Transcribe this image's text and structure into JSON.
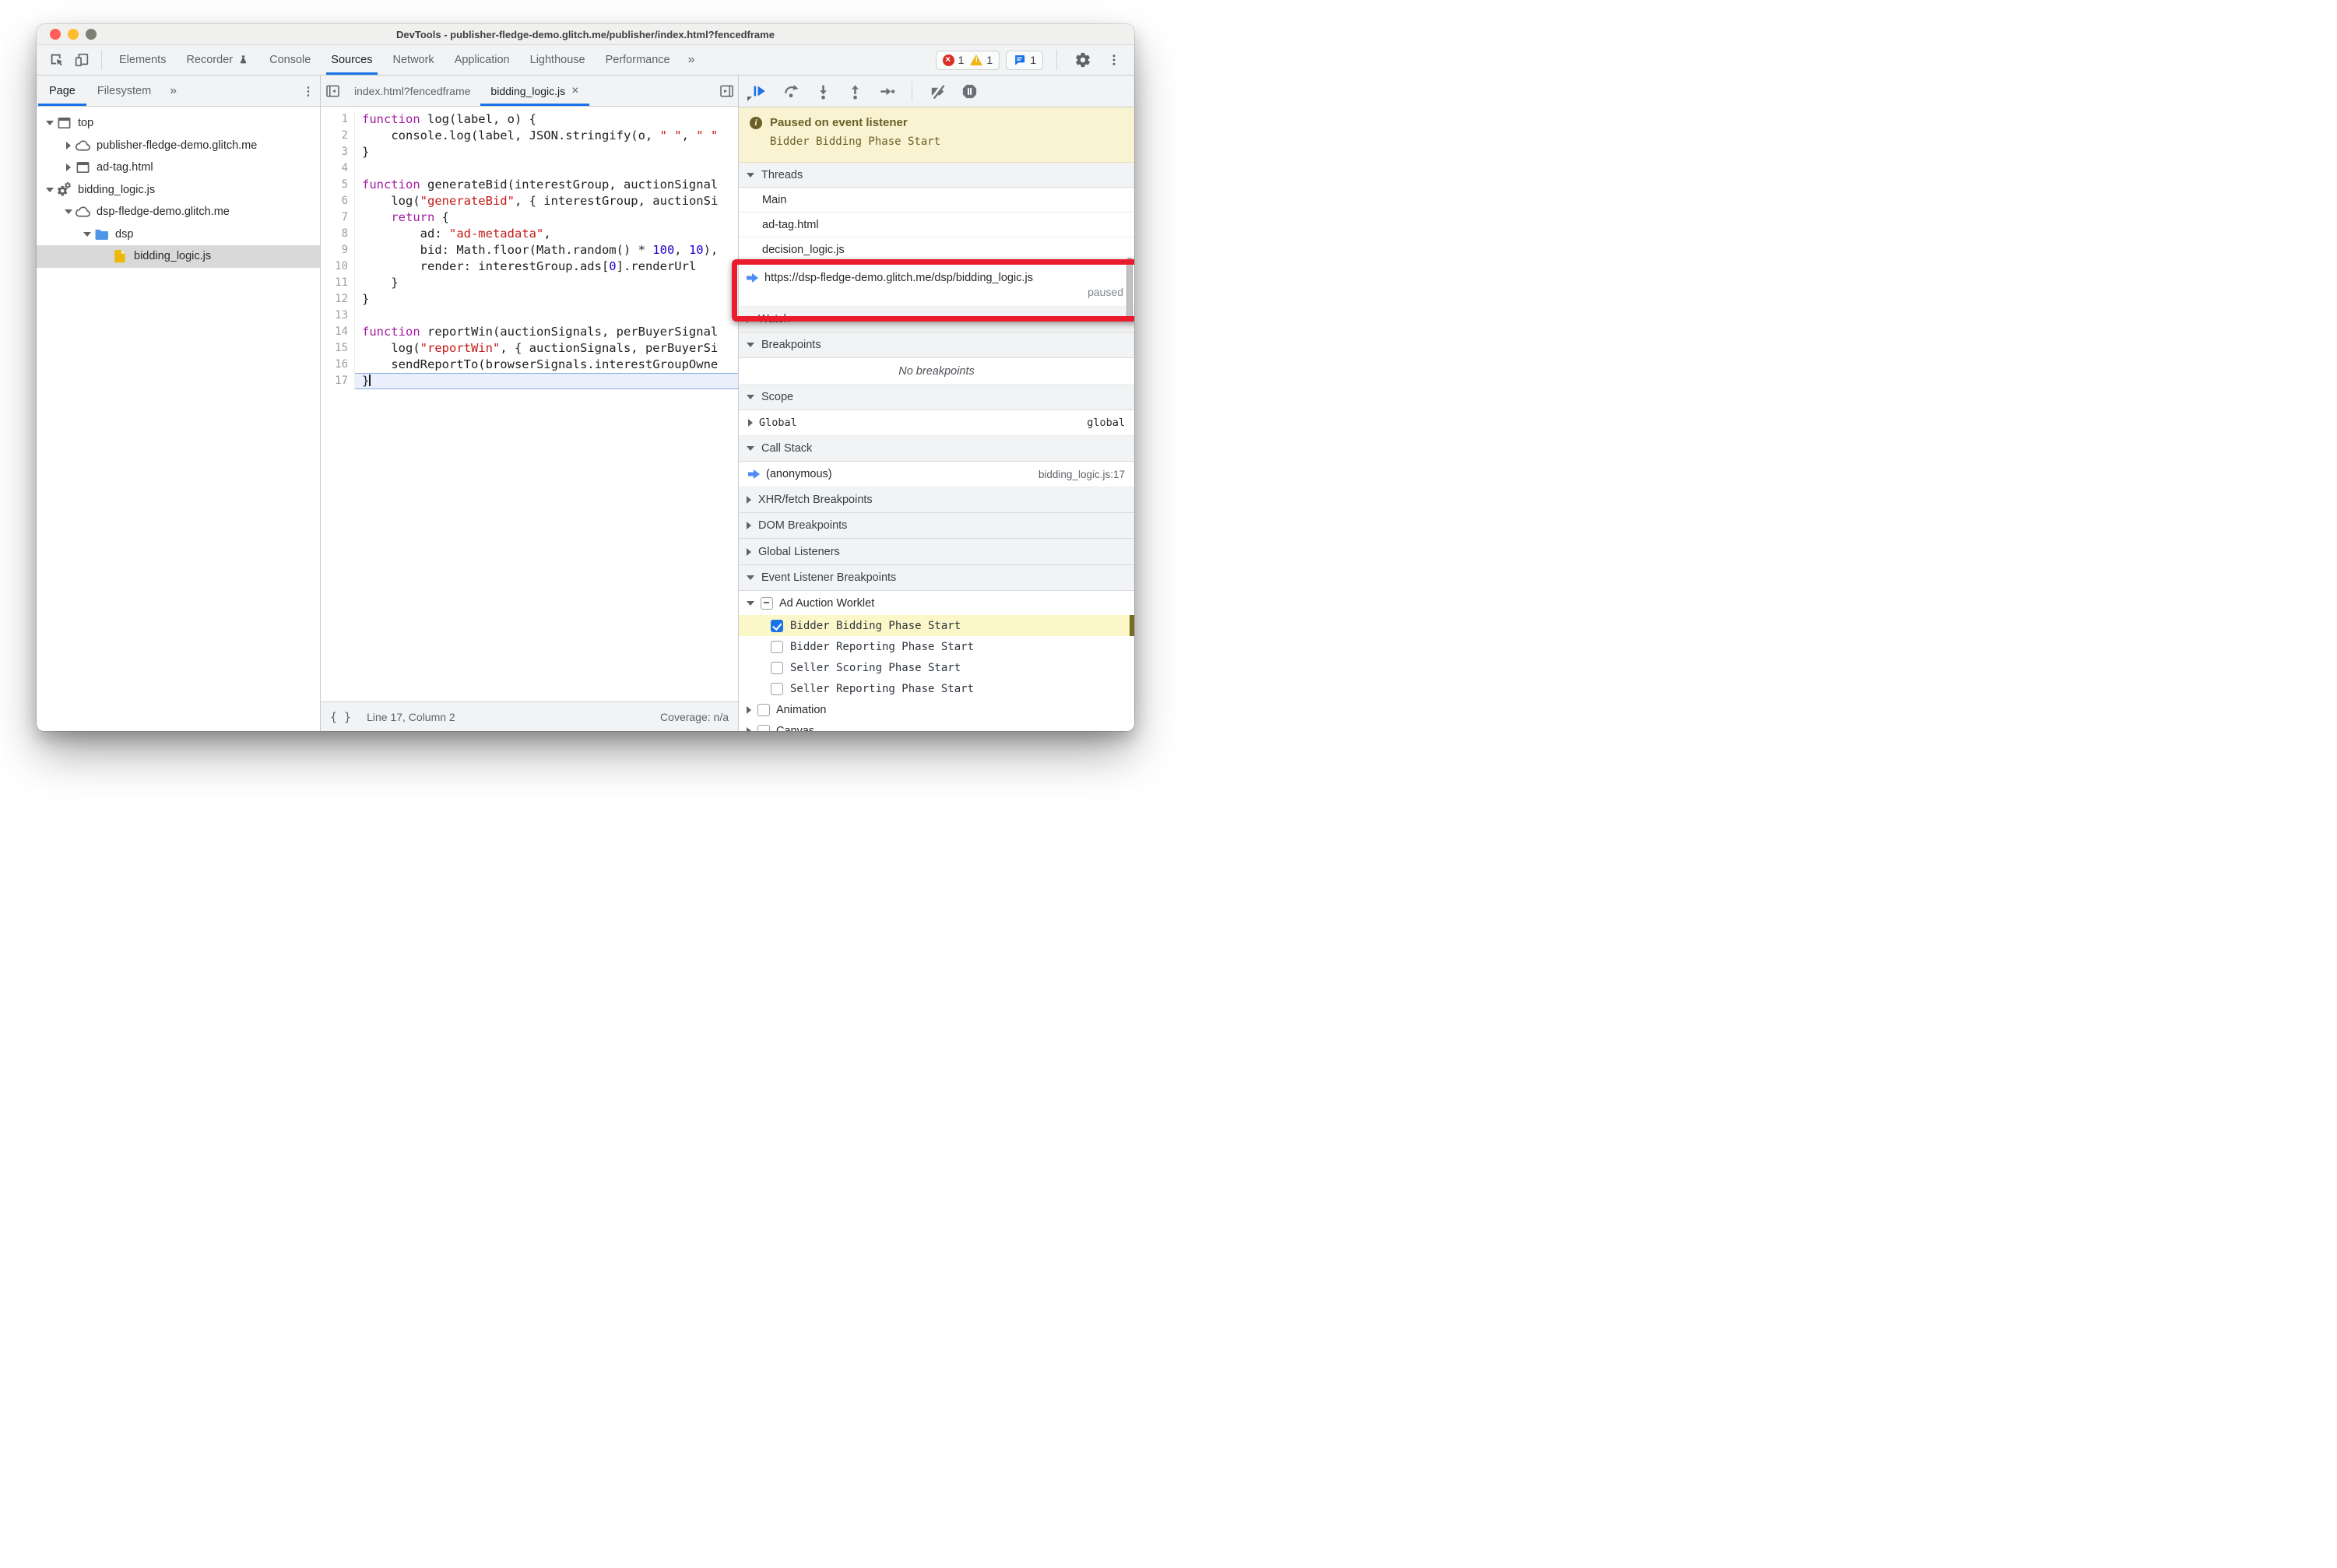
{
  "colors": {
    "accent": "#1a73e8",
    "annotation_red": "#ea1b2c",
    "paused_banner_bg": "#faf3d2",
    "paused_banner_text": "#6a5f27",
    "highlight_row_bg": "#fbf7c8",
    "exec_line_bg": "#e9f0fc",
    "keyword": "#a41ea3",
    "string": "#c41a16",
    "number": "#1c00cf",
    "folder_icon": "#5096e8",
    "file_icon": "#edb80b",
    "traffic_red": "#ff5f57",
    "traffic_yellow": "#febc2e",
    "traffic_gray": "#7e8071"
  },
  "window": {
    "title": "DevTools - publisher-fledge-demo.glitch.me/publisher/index.html?fencedframe"
  },
  "toolbar": {
    "tabs": [
      {
        "label": "Elements",
        "active": false,
        "flask": false
      },
      {
        "label": "Recorder",
        "active": false,
        "flask": true
      },
      {
        "label": "Console",
        "active": false,
        "flask": false
      },
      {
        "label": "Sources",
        "active": true,
        "flask": false
      },
      {
        "label": "Network",
        "active": false,
        "flask": false
      },
      {
        "label": "Application",
        "active": false,
        "flask": false
      },
      {
        "label": "Lighthouse",
        "active": false,
        "flask": false
      },
      {
        "label": "Performance",
        "active": false,
        "flask": false
      }
    ],
    "overflow": "»",
    "badges": {
      "errors": "1",
      "warnings": "1",
      "messages": "1"
    }
  },
  "navigator": {
    "tabs": [
      {
        "label": "Page",
        "active": true
      },
      {
        "label": "Filesystem",
        "active": false
      }
    ],
    "overflow": "»",
    "tree": [
      {
        "depth": 0,
        "expand": "open",
        "icon": "frame",
        "label": "top",
        "selected": false
      },
      {
        "depth": 1,
        "expand": "closed",
        "icon": "cloud",
        "label": "publisher-fledge-demo.glitch.me",
        "selected": false
      },
      {
        "depth": 1,
        "expand": "closed",
        "icon": "frame",
        "label": "ad-tag.html",
        "selected": false
      },
      {
        "depth": 0,
        "expand": "open",
        "icon": "gears",
        "label": "bidding_logic.js",
        "selected": false
      },
      {
        "depth": 1,
        "expand": "open",
        "icon": "cloud",
        "label": "dsp-fledge-demo.glitch.me",
        "selected": false
      },
      {
        "depth": 2,
        "expand": "open",
        "icon": "folder",
        "label": "dsp",
        "selected": false
      },
      {
        "depth": 3,
        "expand": "none",
        "icon": "file",
        "label": "bidding_logic.js",
        "selected": true
      }
    ]
  },
  "editor": {
    "tabs": [
      {
        "label": "index.html?fencedframe",
        "active": false,
        "closable": false
      },
      {
        "label": "bidding_logic.js",
        "active": true,
        "closable": true
      }
    ],
    "lines": [
      {
        "n": 1,
        "exec": false,
        "tokens": [
          [
            "kw",
            "function"
          ],
          [
            "plain",
            " log(label, o) {"
          ]
        ]
      },
      {
        "n": 2,
        "exec": false,
        "tokens": [
          [
            "plain",
            "    console.log(label, JSON.stringify(o, "
          ],
          [
            "str",
            "\" \""
          ],
          [
            "plain",
            ", "
          ],
          [
            "str",
            "\" \""
          ]
        ]
      },
      {
        "n": 3,
        "exec": false,
        "tokens": [
          [
            "plain",
            "}"
          ]
        ]
      },
      {
        "n": 4,
        "exec": false,
        "tokens": []
      },
      {
        "n": 5,
        "exec": false,
        "tokens": [
          [
            "kw",
            "function"
          ],
          [
            "plain",
            " generateBid(interestGroup, auctionSignal"
          ]
        ]
      },
      {
        "n": 6,
        "exec": false,
        "tokens": [
          [
            "plain",
            "    log("
          ],
          [
            "str",
            "\"generateBid\""
          ],
          [
            "plain",
            ", { interestGroup, auctionSi"
          ]
        ]
      },
      {
        "n": 7,
        "exec": false,
        "tokens": [
          [
            "plain",
            "    "
          ],
          [
            "kw",
            "return"
          ],
          [
            "plain",
            " {"
          ]
        ]
      },
      {
        "n": 8,
        "exec": false,
        "tokens": [
          [
            "plain",
            "        ad: "
          ],
          [
            "str",
            "\"ad-metadata\""
          ],
          [
            "plain",
            ","
          ]
        ]
      },
      {
        "n": 9,
        "exec": false,
        "tokens": [
          [
            "plain",
            "        bid: Math.floor(Math.random() * "
          ],
          [
            "num",
            "100"
          ],
          [
            "plain",
            ", "
          ],
          [
            "num",
            "10"
          ],
          [
            "plain",
            "),"
          ]
        ]
      },
      {
        "n": 10,
        "exec": false,
        "tokens": [
          [
            "plain",
            "        render: interestGroup.ads["
          ],
          [
            "num",
            "0"
          ],
          [
            "plain",
            "].renderUrl"
          ]
        ]
      },
      {
        "n": 11,
        "exec": false,
        "tokens": [
          [
            "plain",
            "    }"
          ]
        ]
      },
      {
        "n": 12,
        "exec": false,
        "tokens": [
          [
            "plain",
            "}"
          ]
        ]
      },
      {
        "n": 13,
        "exec": false,
        "tokens": []
      },
      {
        "n": 14,
        "exec": false,
        "tokens": [
          [
            "kw",
            "function"
          ],
          [
            "plain",
            " reportWin(auctionSignals, perBuyerSignal"
          ]
        ]
      },
      {
        "n": 15,
        "exec": false,
        "tokens": [
          [
            "plain",
            "    log("
          ],
          [
            "str",
            "\"reportWin\""
          ],
          [
            "plain",
            ", { auctionSignals, perBuyerSi"
          ]
        ]
      },
      {
        "n": 16,
        "exec": false,
        "tokens": [
          [
            "plain",
            "    sendReportTo(browserSignals.interestGroupOwne"
          ]
        ]
      },
      {
        "n": 17,
        "exec": true,
        "tokens": [
          [
            "plain",
            "}"
          ]
        ]
      }
    ],
    "status": {
      "position": "Line 17, Column 2",
      "coverage": "Coverage: n/a"
    }
  },
  "debugger": {
    "paused": {
      "title": "Paused on event listener",
      "detail": "Bidder Bidding Phase Start"
    },
    "threads": {
      "label": "Threads",
      "items": [
        {
          "label": "Main",
          "current": false,
          "status": ""
        },
        {
          "label": "ad-tag.html",
          "current": false,
          "status": ""
        },
        {
          "label": "decision_logic.js",
          "current": false,
          "status": ""
        },
        {
          "label": "https://dsp-fledge-demo.glitch.me/dsp/bidding_logic.js",
          "current": true,
          "status": "paused"
        }
      ]
    },
    "watch": {
      "label": "Watch"
    },
    "breakpoints": {
      "label": "Breakpoints",
      "empty": "No breakpoints"
    },
    "scope": {
      "label": "Scope",
      "items": [
        {
          "name": "Global",
          "value": "global"
        }
      ]
    },
    "call_stack": {
      "label": "Call Stack",
      "frames": [
        {
          "name": "(anonymous)",
          "location": "bidding_logic.js:17",
          "current": true
        }
      ]
    },
    "xhr": {
      "label": "XHR/fetch Breakpoints"
    },
    "dom": {
      "label": "DOM Breakpoints"
    },
    "global_listeners": {
      "label": "Global Listeners"
    },
    "event_listener_breakpoints": {
      "label": "Event Listener Breakpoints",
      "groups": [
        {
          "label": "Ad Auction Worklet",
          "state": "indeterminate",
          "expanded": true,
          "children": [
            {
              "label": "Bidder Bidding Phase Start",
              "checked": true,
              "highlighted": true
            },
            {
              "label": "Bidder Reporting Phase Start",
              "checked": false,
              "highlighted": false
            },
            {
              "label": "Seller Scoring Phase Start",
              "checked": false,
              "highlighted": false
            },
            {
              "label": "Seller Reporting Phase Start",
              "checked": false,
              "highlighted": false
            }
          ]
        },
        {
          "label": "Animation",
          "state": "unchecked",
          "expanded": false,
          "children": []
        },
        {
          "label": "Canvas",
          "state": "unchecked",
          "expanded": false,
          "children": []
        }
      ]
    }
  }
}
